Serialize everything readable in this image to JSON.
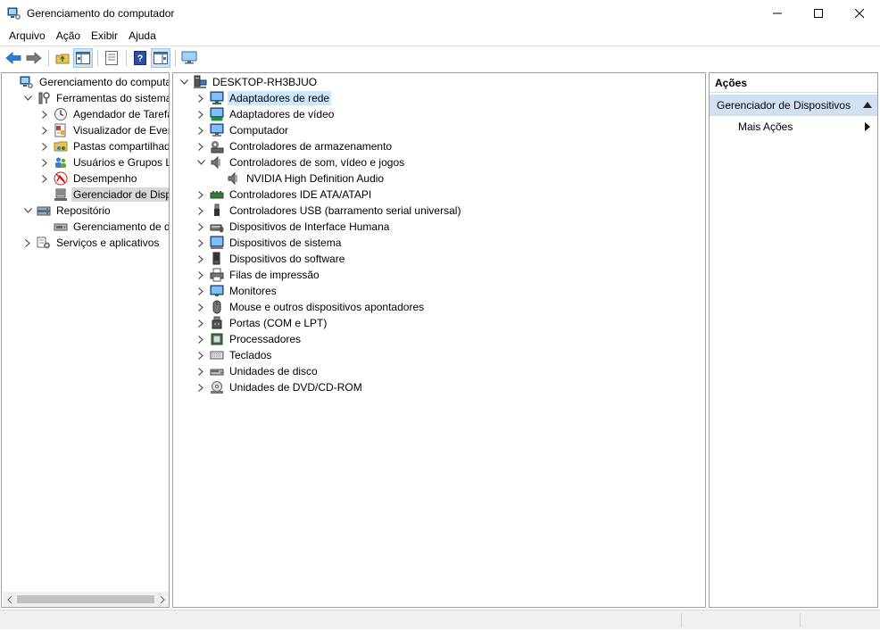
{
  "window": {
    "title": "Gerenciamento do computador",
    "icon": "computer-management-icon"
  },
  "menu": {
    "items": [
      "Arquivo",
      "Ação",
      "Exibir",
      "Ajuda"
    ]
  },
  "toolbar": {
    "icons": [
      "back-icon",
      "forward-icon",
      "up-folder-icon",
      "show-hide-tree-icon",
      "properties-icon",
      "help-icon",
      "show-hide-action-pane-icon",
      "monitor-icon"
    ]
  },
  "left_tree": {
    "items": [
      {
        "label": "Gerenciamento do computado",
        "icon": "computer-management-icon",
        "level": 0,
        "expander": "none"
      },
      {
        "label": "Ferramentas do sistema",
        "icon": "system-tools-icon",
        "level": 1,
        "expander": "expanded"
      },
      {
        "label": "Agendador de Tarefas",
        "icon": "clock-icon",
        "level": 2,
        "expander": "collapsed"
      },
      {
        "label": "Visualizador de Eventos",
        "icon": "event-viewer-icon",
        "level": 2,
        "expander": "collapsed"
      },
      {
        "label": "Pastas compartilhadas",
        "icon": "shared-folders-icon",
        "level": 2,
        "expander": "collapsed"
      },
      {
        "label": "Usuários e Grupos Loca",
        "icon": "users-icon",
        "level": 2,
        "expander": "collapsed"
      },
      {
        "label": "Desempenho",
        "icon": "performance-icon",
        "level": 2,
        "expander": "collapsed"
      },
      {
        "label": "Gerenciador de Disposit",
        "icon": "device-manager-icon",
        "level": 2,
        "expander": "none",
        "selected": true
      },
      {
        "label": "Repositório",
        "icon": "storage-icon",
        "level": 1,
        "expander": "expanded"
      },
      {
        "label": "Gerenciamento de disco",
        "icon": "disk-management-icon",
        "level": 2,
        "expander": "none"
      },
      {
        "label": "Serviços e aplicativos",
        "icon": "services-icon",
        "level": 1,
        "expander": "collapsed"
      }
    ]
  },
  "device_tree": {
    "root": "DESKTOP-RH3BJUO",
    "items": [
      {
        "label": "Adaptadores de rede",
        "icon": "network-adapter-icon",
        "expander": "collapsed",
        "selected": true
      },
      {
        "label": "Adaptadores de vídeo",
        "icon": "display-adapter-icon",
        "expander": "collapsed"
      },
      {
        "label": "Computador",
        "icon": "computer-icon",
        "expander": "collapsed"
      },
      {
        "label": "Controladores de armazenamento",
        "icon": "storage-controller-icon",
        "expander": "collapsed"
      },
      {
        "label": "Controladores de som, vídeo e jogos",
        "icon": "speaker-icon",
        "expander": "expanded"
      },
      {
        "label": "NVIDIA High Definition Audio",
        "icon": "speaker-icon",
        "expander": "none",
        "child": true
      },
      {
        "label": "Controladores IDE ATA/ATAPI",
        "icon": "ide-controller-icon",
        "expander": "collapsed"
      },
      {
        "label": "Controladores USB (barramento serial universal)",
        "icon": "usb-icon",
        "expander": "collapsed"
      },
      {
        "label": "Dispositivos de Interface Humana",
        "icon": "hid-icon",
        "expander": "collapsed"
      },
      {
        "label": "Dispositivos de sistema",
        "icon": "system-device-icon",
        "expander": "collapsed"
      },
      {
        "label": "Dispositivos do software",
        "icon": "software-device-icon",
        "expander": "collapsed"
      },
      {
        "label": "Filas de impressão",
        "icon": "printer-icon",
        "expander": "collapsed"
      },
      {
        "label": "Monitores",
        "icon": "monitor-icon",
        "expander": "collapsed"
      },
      {
        "label": "Mouse e outros dispositivos apontadores",
        "icon": "mouse-icon",
        "expander": "collapsed"
      },
      {
        "label": "Portas (COM e LPT)",
        "icon": "port-icon",
        "expander": "collapsed"
      },
      {
        "label": "Processadores",
        "icon": "processor-icon",
        "expander": "collapsed"
      },
      {
        "label": "Teclados",
        "icon": "keyboard-icon",
        "expander": "collapsed"
      },
      {
        "label": "Unidades de disco",
        "icon": "disk-drive-icon",
        "expander": "collapsed"
      },
      {
        "label": "Unidades de DVD/CD-ROM",
        "icon": "dvd-icon",
        "expander": "collapsed"
      }
    ]
  },
  "actions": {
    "title": "Ações",
    "group": "Gerenciador de Dispositivos",
    "more": "Mais Ações"
  },
  "colors": {
    "selection_blue": "#cce8ff",
    "selection_grey": "#d9d9d9",
    "actions_header": "#d0e2f2"
  }
}
